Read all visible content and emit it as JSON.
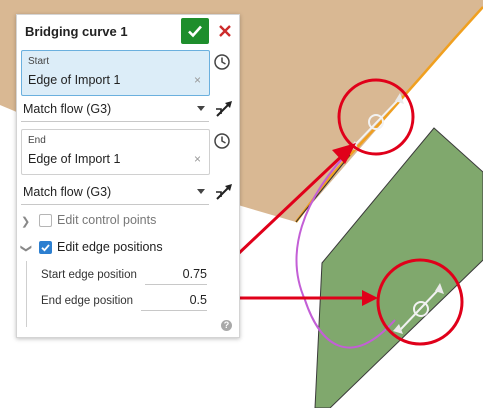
{
  "dialog": {
    "title": "Bridging curve 1",
    "start": {
      "label": "Start",
      "value": "Edge of Import 1",
      "clear": "×"
    },
    "start_match": "Match flow (G3)",
    "end": {
      "label": "End",
      "value": "Edge of Import 1",
      "clear": "×"
    },
    "end_match": "Match flow (G3)",
    "edit_control_points": {
      "label": "Edit control points",
      "checked": false
    },
    "edit_edge_positions": {
      "label": "Edit edge positions",
      "checked": true
    },
    "start_edge_position": {
      "label": "Start edge position",
      "value": "0.75"
    },
    "end_edge_position": {
      "label": "End edge position",
      "value": "0.5"
    },
    "help": "?"
  },
  "colors": {
    "accept": "#1e8e2c",
    "cancel": "#cc2b2b",
    "selected_field": "#dcedf8",
    "face_upper": "#d9b893",
    "face_lower": "#80a86d",
    "edge_highlight": "#f0a020",
    "bridging_curve": "#c35fd6",
    "annotation": "#e0001a"
  }
}
